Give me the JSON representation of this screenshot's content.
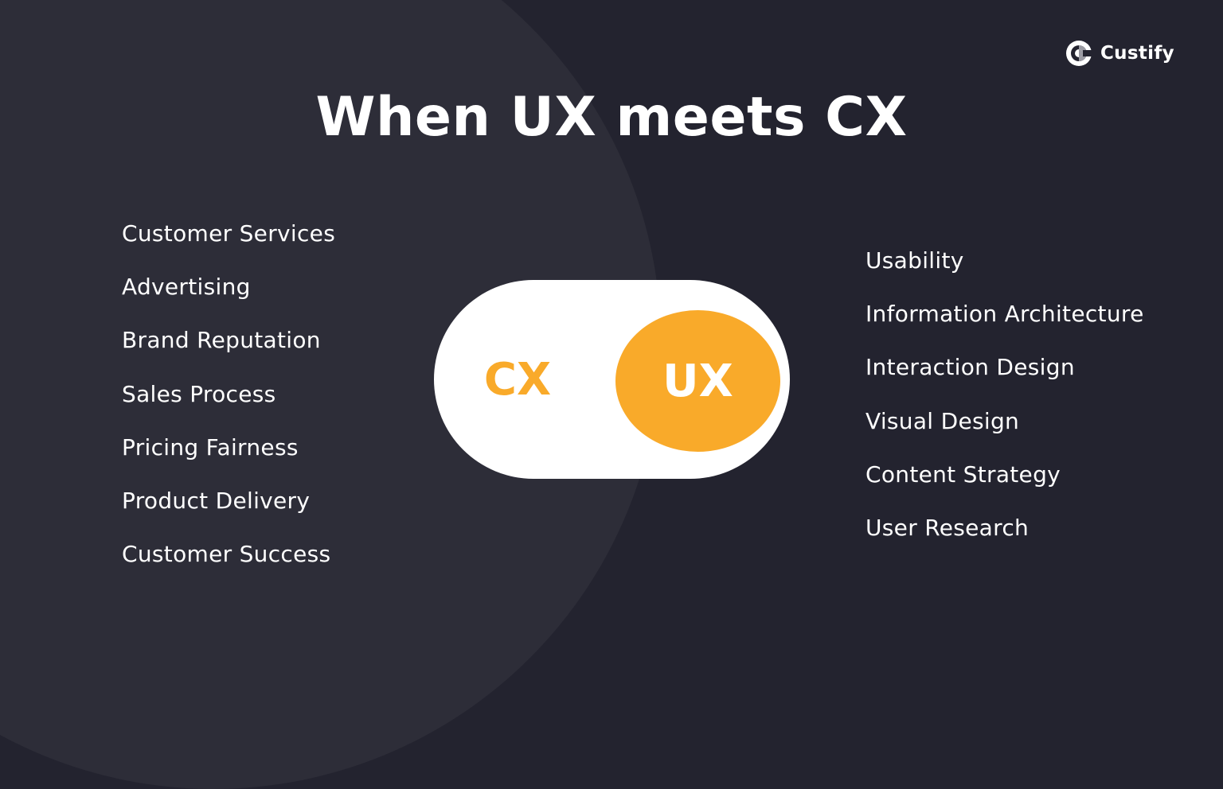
{
  "brand": {
    "name": "Custify",
    "icon": "custify-logo-icon"
  },
  "title": "When UX meets CX",
  "cx_list": {
    "items": [
      "Customer Services",
      "Advertising",
      "Brand Reputation",
      "Sales Process",
      "Pricing Fairness",
      "Product Delivery",
      "Customer Success"
    ]
  },
  "ux_list": {
    "items": [
      "Usability",
      "Information Architecture",
      "Interaction Design",
      "Visual Design",
      "Content Strategy",
      "User Research"
    ]
  },
  "toggle": {
    "off_label": "CX",
    "on_label": "UX",
    "state": "UX",
    "accent_color": "#f9aa2a"
  },
  "colors": {
    "background": "#23232f",
    "circle": "#2d2d38",
    "text": "#ffffff",
    "accent": "#f9aa2a"
  }
}
